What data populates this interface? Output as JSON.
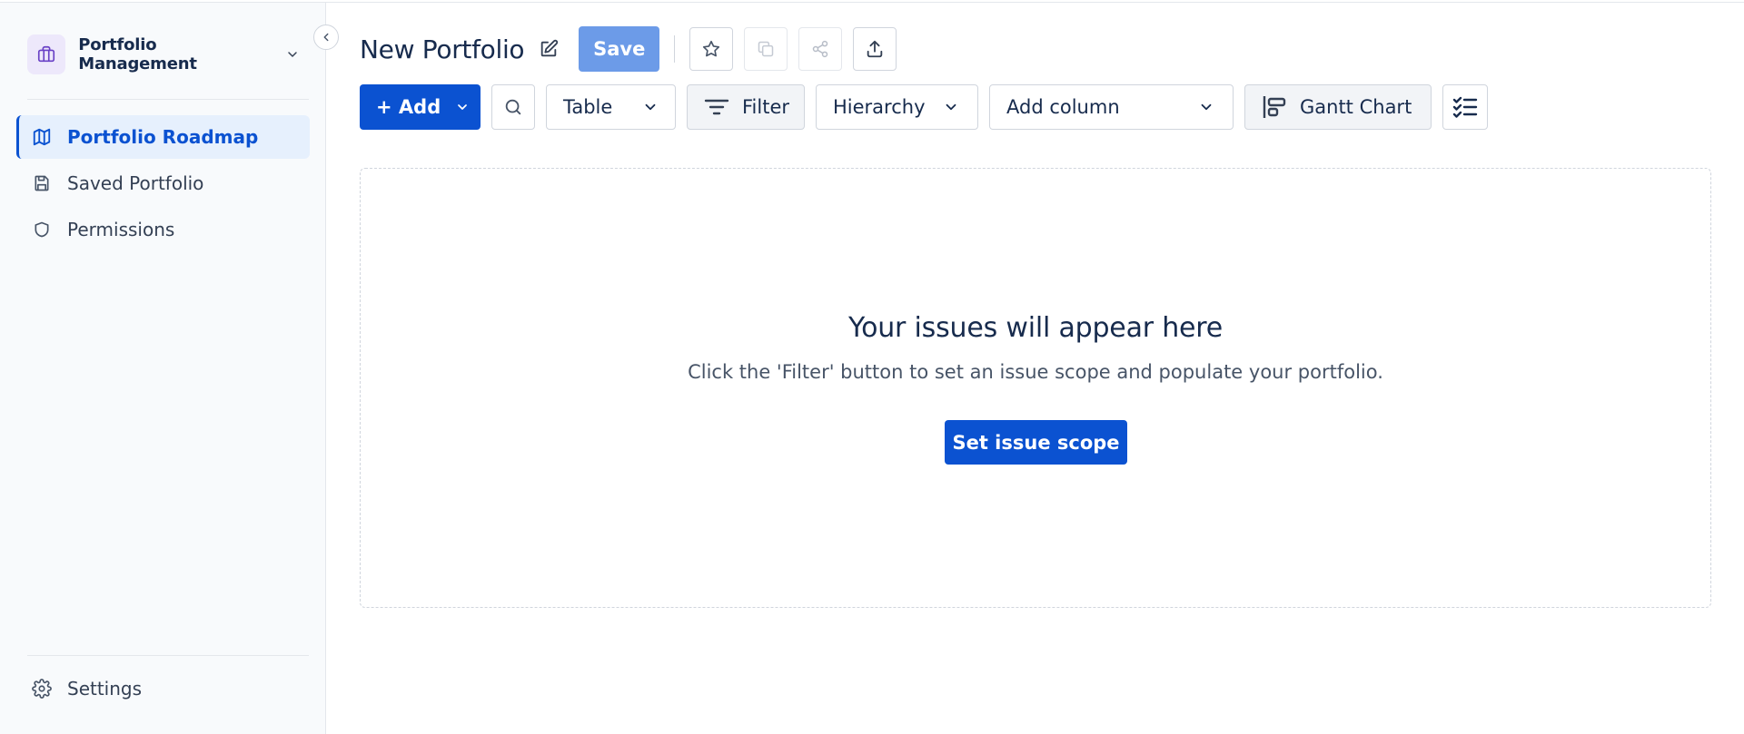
{
  "sidebar": {
    "workspace_name": "Portfolio Management",
    "nav": [
      {
        "label": "Portfolio Roadmap",
        "icon": "map-icon",
        "active": true
      },
      {
        "label": "Saved Portfolio",
        "icon": "save-icon",
        "active": false
      },
      {
        "label": "Permissions",
        "icon": "shield-icon",
        "active": false
      }
    ],
    "settings_label": "Settings"
  },
  "header": {
    "title": "New Portfolio",
    "save_label": "Save"
  },
  "toolbar": {
    "add_label": "+ Add",
    "view_select": "Table",
    "filter_label": "Filter",
    "hierarchy_select": "Hierarchy",
    "add_column_select": "Add column",
    "gantt_label": "Gantt Chart"
  },
  "empty_state": {
    "title": "Your issues will appear here",
    "description": "Click the 'Filter' button to set an issue scope and populate your portfolio.",
    "button_label": "Set issue scope"
  },
  "colors": {
    "primary": "#0b52d1",
    "save_disabled": "#6c9be8",
    "active_bg": "#e6f0fd",
    "sidebar_bg": "#f8fafc",
    "workspace_logo_bg": "#ede8fb"
  }
}
